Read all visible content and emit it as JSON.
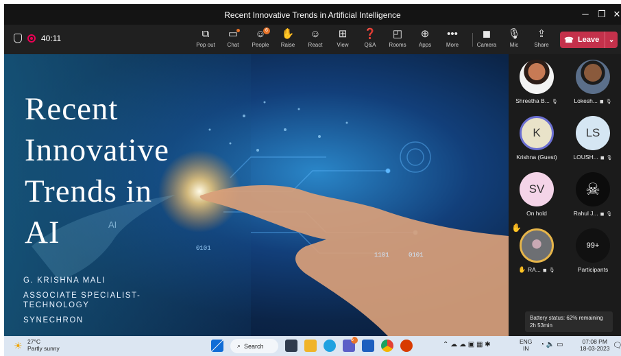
{
  "window": {
    "title": "Recent Innovative Trends in Artificial Intelligence"
  },
  "toolbar": {
    "timer": "40:11",
    "buttons": [
      {
        "label": "Pop out",
        "icon": "popout-icon"
      },
      {
        "label": "Chat",
        "icon": "chat-icon"
      },
      {
        "label": "People",
        "icon": "people-icon",
        "badge": "6"
      },
      {
        "label": "Raise",
        "icon": "raise-hand-icon"
      },
      {
        "label": "React",
        "icon": "smiley-icon"
      },
      {
        "label": "View",
        "icon": "grid-view-icon"
      },
      {
        "label": "Q&A",
        "icon": "qa-icon"
      },
      {
        "label": "Rooms",
        "icon": "rooms-icon"
      },
      {
        "label": "Apps",
        "icon": "apps-plus-icon"
      },
      {
        "label": "More",
        "icon": "more-icon"
      },
      {
        "label": "Camera",
        "icon": "camera-off-icon"
      },
      {
        "label": "Mic",
        "icon": "mic-off-icon"
      },
      {
        "label": "Share",
        "icon": "share-icon"
      }
    ],
    "leave_label": "Leave"
  },
  "slide": {
    "title_lines": [
      "Recent",
      "Innovative",
      "Trends in",
      "AI"
    ],
    "presenter": "G. KRISHNA MALI",
    "role_line1": "ASSOCIATE SPECIALIST-",
    "role_line2": "TECHNOLOGY",
    "company": "SYNECHRON",
    "art_texts": [
      "0101",
      "1101",
      "0101",
      "AI"
    ]
  },
  "participants": {
    "tiles": [
      {
        "name": "Shreetha B...",
        "initials": ""
      },
      {
        "name": "Lokesh...",
        "initials": ""
      },
      {
        "name": "Krishna (Guest)",
        "initials": "K"
      },
      {
        "name": "LOUSH...",
        "initials": "LS"
      },
      {
        "name": "On hold",
        "initials": "SV"
      },
      {
        "name": "Rahul J...",
        "initials": ""
      },
      {
        "name": "RA...",
        "initials": ""
      },
      {
        "name": "Participants",
        "initials": "99+"
      }
    ]
  },
  "notification": {
    "line1": "Battery status: 62% remaining",
    "line2": "2h 53min"
  },
  "taskbar": {
    "weather_temp": "27°C",
    "weather_text": "Partly sunny",
    "search_label": "Search",
    "teams_badge": "6",
    "lang1": "ENG",
    "lang2": "IN",
    "time": "07:08 PM",
    "date": "18-03-2023"
  }
}
